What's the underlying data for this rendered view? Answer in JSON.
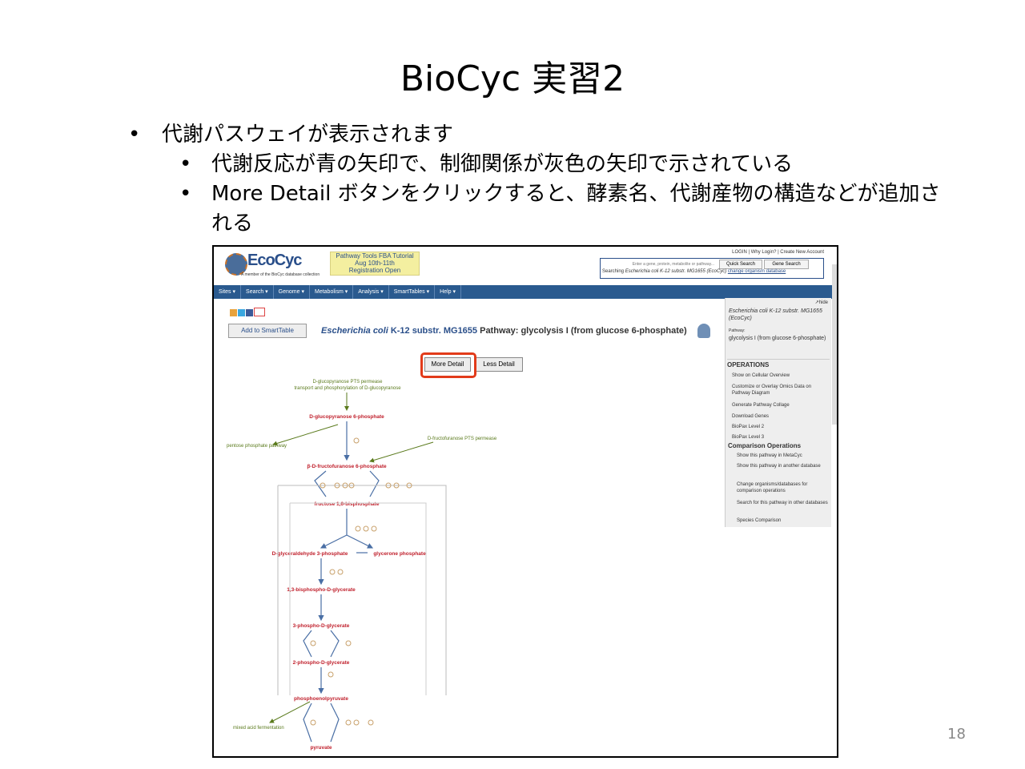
{
  "slide": {
    "title": "BioCyc 実習2",
    "bullet1": "代謝パスウェイが表示されます",
    "bullet2": "代謝反応が青の矢印で、制御関係が灰色の矢印で示されている",
    "bullet3": "More Detail ボタンをクリックすると、酵素名、代謝産物の構造などが追加される",
    "page_number": "18"
  },
  "app": {
    "logo": "EcoCyc",
    "logo_sub": "A member of the BioCyc database collection",
    "banner": [
      "Pathway Tools FBA Tutorial",
      "Aug 10th-11th",
      "Registration Open"
    ],
    "top_links": "LOGIN | Why Login? | Create New Account",
    "search": {
      "placeholder": "Enter a gene, protein, metabolite or pathway...",
      "quick_search": "Quick Search",
      "gene_search": "Gene Search",
      "searching_prefix": "Searching",
      "organism": "Escherichia coli K-12 substr. MG1655 (EcoCyc)",
      "change_link": "change organism database"
    },
    "nav": [
      "Sites ▾",
      "Search ▾",
      "Genome ▾",
      "Metabolism ▾",
      "Analysis ▾",
      "SmartTables ▾",
      "Help ▾"
    ],
    "add_smarttable": "Add to SmartTable",
    "pathway_title": {
      "species": "Escherichia coli",
      "strain": " K-12 substr. MG1655",
      "rest": " Pathway: glycolysis I (from glucose 6-phosphate)"
    },
    "more_detail": "More Detail",
    "less_detail": "Less Detail",
    "sidebar": {
      "hide": "hide",
      "organism": "Escherichia coli K-12 substr. MG1655 (EcoCyc)",
      "pathway_label": "Pathway:",
      "pathway_name": "glycolysis I (from glucose 6-phosphate)",
      "operations_header": "OPERATIONS",
      "operations": [
        "Show on Cellular Overview",
        "Customize or Overlay Omics Data on Pathway Diagram",
        "Generate Pathway Collage",
        "Download Genes",
        "BioPax Level 2",
        "BioPax Level 3"
      ],
      "comparison_header": "Comparison Operations",
      "comparison": [
        "Show this pathway in MetaCyc",
        "Show this pathway in another database",
        "Change organisms/databases for comparison operations",
        "Search for this pathway in other databases",
        "Species Comparison"
      ]
    },
    "diagram": {
      "enzymes": [
        "D-glucopyranose PTS permease",
        "transport and phosphorylation of D-glucopyranose",
        "D-fructofuranose PTS permease"
      ],
      "side_pathways": [
        "pentose phosphate pathway",
        "mixed acid fermentation"
      ],
      "metabolites": [
        "D-glucopyranose 6-phosphate",
        "β-D-fructofuranose 6-phosphate",
        "fructose 1,6-bisphosphate",
        "D-glyceraldehyde 3-phosphate",
        "glycerone phosphate",
        "1,3-bisphospho-D-glycerate",
        "3-phospho-D-glycerate",
        "2-phospho-D-glycerate",
        "phosphoenolpyruvate",
        "pyruvate"
      ]
    }
  },
  "colors": {
    "metabolite": "#c0202c",
    "enzyme": "#5a7a1c",
    "reaction_arrow": "#4a6fa5",
    "highlight": "#e23b1a",
    "nav": "#2a5a8f"
  }
}
